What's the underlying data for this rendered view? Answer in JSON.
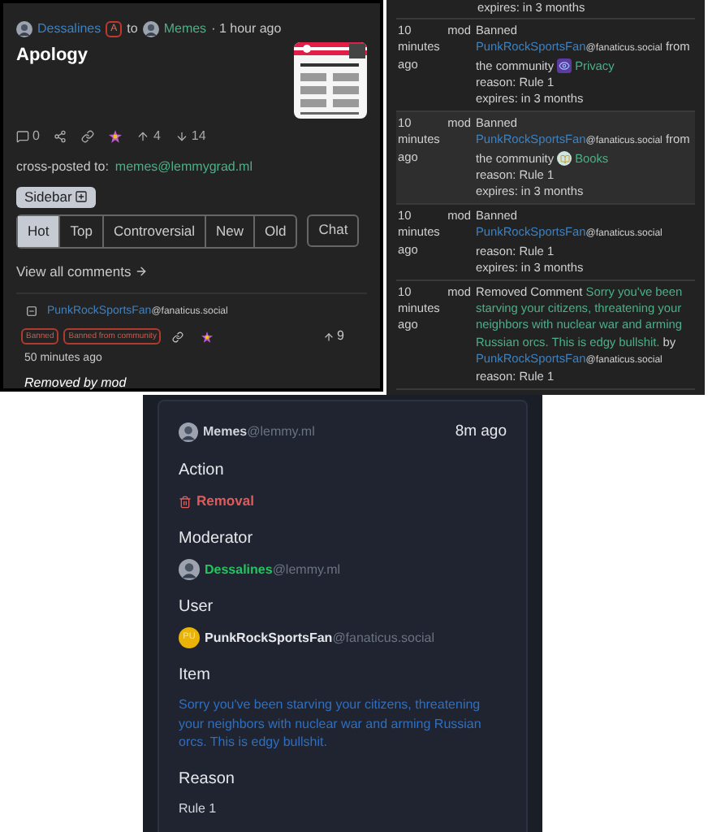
{
  "post": {
    "author": "Dessalines",
    "author_badge": "A",
    "to": "to",
    "community": "Memes",
    "time": "· 1 hour ago",
    "title": "Apology",
    "comments": "0",
    "upvotes": "4",
    "downvotes": "14",
    "crosspost_label": "cross-posted to:",
    "crosspost_link": "memes@lemmygrad.ml",
    "sidebar_button": "Sidebar",
    "sort_tabs": [
      {
        "label": "Hot",
        "selected": true
      },
      {
        "label": "Top",
        "selected": false
      },
      {
        "label": "Controversial",
        "selected": false
      },
      {
        "label": "New",
        "selected": false
      },
      {
        "label": "Old",
        "selected": false
      }
    ],
    "chat_button": "Chat",
    "view_all": "View all comments",
    "comment": {
      "user": "PunkRockSportsFan",
      "instance": "@fanaticus.social",
      "badges": [
        "Banned",
        "Banned from community"
      ],
      "score": "9",
      "time": "50 minutes ago",
      "body": "Removed by mod"
    }
  },
  "modlog": {
    "top_partial": "expires: in 3 months",
    "rows": [
      {
        "kind": "ban",
        "highlighted": false,
        "time": "10 minutes ago",
        "role": "mod",
        "action": "Banned",
        "user": "PunkRockSportsFan",
        "instance": "@fanaticus.social",
        "from": "from the community",
        "community": {
          "name": "Privacy",
          "kind": "eye"
        },
        "reason": "reason: Rule 1",
        "expires": "expires: in 3 months"
      },
      {
        "kind": "ban",
        "highlighted": true,
        "time": "10 minutes ago",
        "role": "mod",
        "action": "Banned",
        "user": "PunkRockSportsFan",
        "instance": "@fanaticus.social",
        "from": "from the community",
        "community": {
          "name": "Books",
          "kind": "book"
        },
        "reason": "reason: Rule 1",
        "expires": "expires: in 3 months"
      },
      {
        "kind": "ban",
        "highlighted": false,
        "time": "10 minutes ago",
        "role": "mod",
        "action": "Banned",
        "user": "PunkRockSportsFan",
        "instance": "@fanaticus.social",
        "reason": "reason: Rule 1",
        "expires": "expires: in 3 months"
      },
      {
        "kind": "remove_comment",
        "highlighted": false,
        "time": "10 minutes ago",
        "role": "mod",
        "action": "Removed Comment",
        "comment": "Sorry you've been starving your citizens, threatening your neighbors with nuclear war and arming Russian orcs. This is edgy bullshit.",
        "by": "by",
        "user": "PunkRockSportsFan",
        "instance": "@fanaticus.social",
        "reason": "reason: Rule 1"
      }
    ]
  },
  "card": {
    "community": "Memes",
    "community_instance": "@lemmy.ml",
    "time": "8m ago",
    "sections": [
      {
        "kind": "action",
        "title": "Action",
        "value": "Removal"
      },
      {
        "kind": "moderator",
        "title": "Moderator",
        "name": "Dessalines",
        "instance": "@lemmy.ml"
      },
      {
        "kind": "user",
        "title": "User",
        "name": "PunkRockSportsFan",
        "instance": "@fanaticus.social",
        "avatar": "PU"
      },
      {
        "kind": "link",
        "title": "Item",
        "value": "Sorry you've been starving your citizens, threatening your neighbors with nuclear war and arming Russian orcs. This is edgy bullshit."
      },
      {
        "kind": "text",
        "title": "Reason",
        "value": "Rule 1"
      }
    ]
  }
}
